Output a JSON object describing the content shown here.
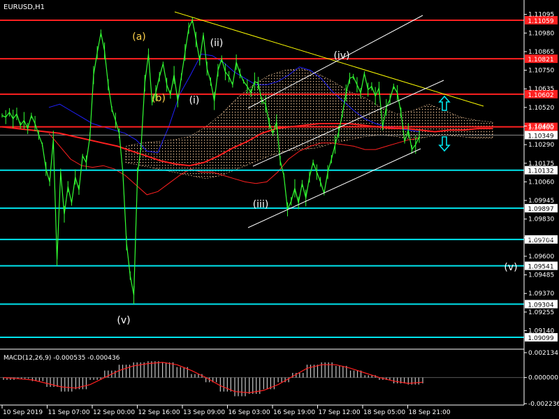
{
  "header": {
    "symbol": "EURUSD,H1"
  },
  "macd_label": "MACD(12,26,9) -0.000535 -0.000436",
  "colors": {
    "background": "#000000",
    "price": "#33ff33",
    "resistance": "#ff2020",
    "support": "#00e5ee",
    "trendline": "#ffff00",
    "channel": "#ffffff",
    "ma_red": "#ff2020",
    "band_blue": "#2020ff",
    "cloud": "#ffd0a0",
    "macd_hist": "#c8c8c8",
    "macd_signal": "#ff2020",
    "wave_yellow": "#ffd24a",
    "wave_white": "#ffffff",
    "arrow": "#00e5ee"
  },
  "chart_data": {
    "type": "line",
    "title": "EURUSD,H1",
    "ylim": [
      1.09055,
      1.11095
    ],
    "price_ticks": [
      "1.11095",
      "1.10980",
      "1.10865",
      "1.10750",
      "1.10635",
      "1.10520",
      "1.10405",
      "1.10290",
      "1.10175",
      "1.10060",
      "1.09945",
      "1.09830",
      "1.09715",
      "1.09600",
      "1.09485",
      "1.09370",
      "1.09255",
      "1.09140"
    ],
    "x_labels": [
      "10 Sep 2019",
      "11 Sep 07:00",
      "12 Sep 00:00",
      "12 Sep 16:00",
      "13 Sep 09:00",
      "16 Sep 03:00",
      "16 Sep 19:00",
      "17 Sep 12:00",
      "18 Sep 05:00",
      "18 Sep 21:00"
    ],
    "resistance_levels": [
      {
        "label": "1.11059",
        "value": 1.11059
      },
      {
        "label": "1.10821",
        "value": 1.10821
      },
      {
        "label": "1.10602",
        "value": 1.10602
      },
      {
        "label": "1.10400",
        "value": 1.104
      }
    ],
    "current_price": {
      "label": "1.10349",
      "value": 1.10349
    },
    "support_levels": [
      {
        "label": "1.10132",
        "value": 1.10132
      },
      {
        "label": "1.09897",
        "value": 1.09897
      },
      {
        "label": "1.09704",
        "value": 1.09704
      },
      {
        "label": "1.09541",
        "value": 1.09541
      },
      {
        "label": "1.09304",
        "value": 1.09304
      },
      {
        "label": "1.09099",
        "value": 1.09099
      }
    ],
    "price_series": [
      1.1047,
      1.1046,
      1.1049,
      1.1045,
      1.1048,
      1.1041,
      1.1044,
      1.1039,
      1.1047,
      1.1042,
      1.1035,
      1.1029,
      1.1014,
      1.1006,
      1.1032,
      1.0958,
      1.1012,
      1.0986,
      1.1003,
      1.0993,
      1.1009,
      1.1001,
      1.1022,
      1.1018,
      1.1034,
      1.1072,
      1.1086,
      1.1098,
      1.1087,
      1.1066,
      1.1051,
      1.1044,
      1.1036,
      1.1012,
      1.0968,
      1.0948,
      1.0936,
      1.1011,
      1.1028,
      1.1067,
      1.1085,
      1.1055,
      1.1061,
      1.1071,
      1.1079,
      1.1066,
      1.106,
      1.1072,
      1.1056,
      1.1071,
      1.1086,
      1.1101,
      1.1106,
      1.1094,
      1.1081,
      1.1097,
      1.1076,
      1.1068,
      1.1056,
      1.1075,
      1.1082,
      1.1074,
      1.1071,
      1.1066,
      1.108,
      1.1073,
      1.1068,
      1.1065,
      1.1061,
      1.1068,
      1.1067,
      1.1056,
      1.1054,
      1.1042,
      1.1036,
      1.1043,
      1.1019,
      1.101,
      1.0989,
      1.0994,
      1.1002,
      1.0993,
      1.1005,
      1.0996,
      1.1009,
      1.1018,
      1.1012,
      1.1006,
      1.0999,
      1.1012,
      1.102,
      1.1029,
      1.1037,
      1.1048,
      1.1061,
      1.107,
      1.1071,
      1.1066,
      1.1061,
      1.1073,
      1.1063,
      1.1065,
      1.1059,
      1.1064,
      1.104,
      1.1052,
      1.1057,
      1.1065,
      1.1061,
      1.1049,
      1.1031,
      1.1038,
      1.1026,
      1.1029,
      1.1034
    ],
    "ma_series": [
      1.104,
      1.1039,
      1.1038,
      1.1037,
      1.1036,
      1.1034,
      1.1032,
      1.103,
      1.1028,
      1.1025,
      1.1022,
      1.1019,
      1.1017,
      1.1016,
      1.1018,
      1.1022,
      1.1027,
      1.1031,
      1.1036,
      1.1039,
      1.104,
      1.1041,
      1.1042,
      1.1042,
      1.1042,
      1.1041,
      1.104,
      1.1039,
      1.1039,
      1.1038,
      1.1037,
      1.1038,
      1.1038,
      1.1039,
      1.1039
    ],
    "upper_band": [
      1.1052,
      1.1054,
      1.105,
      1.1046,
      1.1042,
      1.104,
      1.1038,
      1.1036,
      1.1032,
      1.1025,
      1.1024,
      1.104,
      1.106,
      1.1072,
      1.1085,
      1.1084,
      1.108,
      1.1074,
      1.107,
      1.1066,
      1.1066,
      1.1068,
      1.1072,
      1.1077,
      1.1075,
      1.107,
      1.1062,
      1.1056,
      1.105,
      1.1045,
      1.1042,
      1.104,
      1.1039,
      1.1038,
      1.1037
    ],
    "lower_band": [
      1.1036,
      1.1028,
      1.102,
      1.1016,
      1.1015,
      1.1016,
      1.1014,
      1.101,
      1.1004,
      1.0998,
      1.1,
      1.1005,
      1.101,
      1.1014,
      1.1012,
      1.1012,
      1.101,
      1.1008,
      1.1006,
      1.1005,
      1.1006,
      1.1012,
      1.102,
      1.1025,
      1.1028,
      1.103,
      1.103,
      1.1029,
      1.1028,
      1.1026,
      1.1026,
      1.1028,
      1.103,
      1.1032,
      1.1033
    ],
    "cloud_top": [
      1.1028,
      1.103,
      1.1031,
      1.1032,
      1.1034,
      1.104,
      1.1048,
      1.1058,
      1.1066,
      1.1072,
      1.1075,
      1.1076,
      1.1073,
      1.1068,
      1.1062,
      1.1058,
      1.1052,
      1.1048,
      1.105,
      1.1054,
      1.105,
      1.1046,
      1.1044,
      1.1043
    ],
    "cloud_bottom": [
      1.1018,
      1.1016,
      1.1014,
      1.1012,
      1.101,
      1.1008,
      1.101,
      1.1014,
      1.1018,
      1.1022,
      1.1025,
      1.1026,
      1.1027,
      1.103,
      1.1032,
      1.1034,
      1.1035,
      1.1034,
      1.1032,
      1.1034,
      1.1035,
      1.1034,
      1.1033,
      1.1033
    ],
    "macd": {
      "ylim": [
        -0.002236,
        0.002134
      ],
      "ticks": [
        "0.002134",
        "0.000000",
        "-0.002236"
      ],
      "hist": [
        -0.0002,
        -0.0001,
        -0.0003,
        -0.0008,
        -0.0012,
        -0.001,
        -0.0002,
        0.0006,
        0.0011,
        0.0013,
        0.0014,
        0.0013,
        0.0009,
        0.0003,
        -0.0004,
        -0.0012,
        -0.0016,
        -0.0014,
        -0.001,
        -0.0004,
        0.0004,
        0.0011,
        0.0013,
        0.001,
        0.0006,
        0.0002,
        -0.0002,
        -0.0005,
        -0.0006,
        -0.0005
      ],
      "signal": [
        0.0,
        -0.0001,
        -0.0002,
        -0.0005,
        -0.0008,
        -0.0009,
        -0.0006,
        0.0,
        0.0006,
        0.001,
        0.0012,
        0.0013,
        0.0011,
        0.0006,
        0.0,
        -0.0007,
        -0.0012,
        -0.0013,
        -0.0011,
        -0.0006,
        0.0001,
        0.0008,
        0.0011,
        0.0011,
        0.0008,
        0.0004,
        0.0,
        -0.0003,
        -0.0005,
        -0.0004
      ]
    },
    "waves": [
      {
        "label": "(a)",
        "color": "yellow",
        "value": 1.1093
      },
      {
        "label": "(b)",
        "color": "yellow",
        "value": 1.1057
      },
      {
        "label": "(v)",
        "color": "white",
        "value": 1.0918
      },
      {
        "label": "(i)",
        "color": "white",
        "value": 1.1057
      },
      {
        "label": "(ii)",
        "color": "white",
        "value": 1.1087
      },
      {
        "label": "(iii)",
        "color": "white",
        "value": 1.0985
      },
      {
        "label": "(iv)",
        "color": "white",
        "value": 1.1077
      },
      {
        "label": "(v)",
        "color": "white",
        "value": 1.0951
      }
    ]
  }
}
